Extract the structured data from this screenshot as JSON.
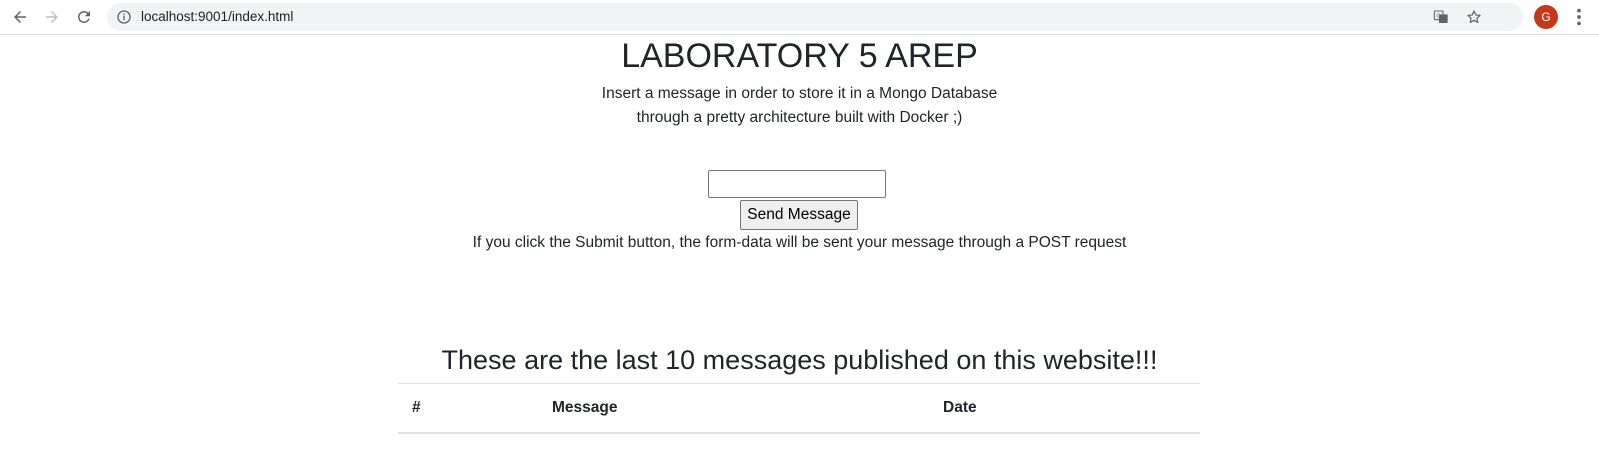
{
  "browser": {
    "url": "localhost:9001/index.html",
    "avatar_letter": "G",
    "icons": [
      "back-icon",
      "forward-icon",
      "reload-icon",
      "info-icon",
      "translate-icon",
      "star-icon",
      "menu-icon"
    ]
  },
  "page": {
    "title": "LABORATORY 5 AREP",
    "intro_line1": "Insert a message in order to store it in a Mongo Database",
    "intro_line2": "through a pretty architecture built with Docker ;)",
    "input_value": "",
    "send_label": "Send Message",
    "hint": "If you click the Submit button, the form-data will be sent your message through a POST request",
    "list_title": "These are the last 10 messages published on this website!!!",
    "table": {
      "columns": [
        "#",
        "Message",
        "Date"
      ],
      "rows": []
    }
  },
  "colors": {
    "text": "#212529",
    "avatar": "#c5391b",
    "omnibox": "#f1f3f4",
    "table_border": "#dee2e6"
  }
}
